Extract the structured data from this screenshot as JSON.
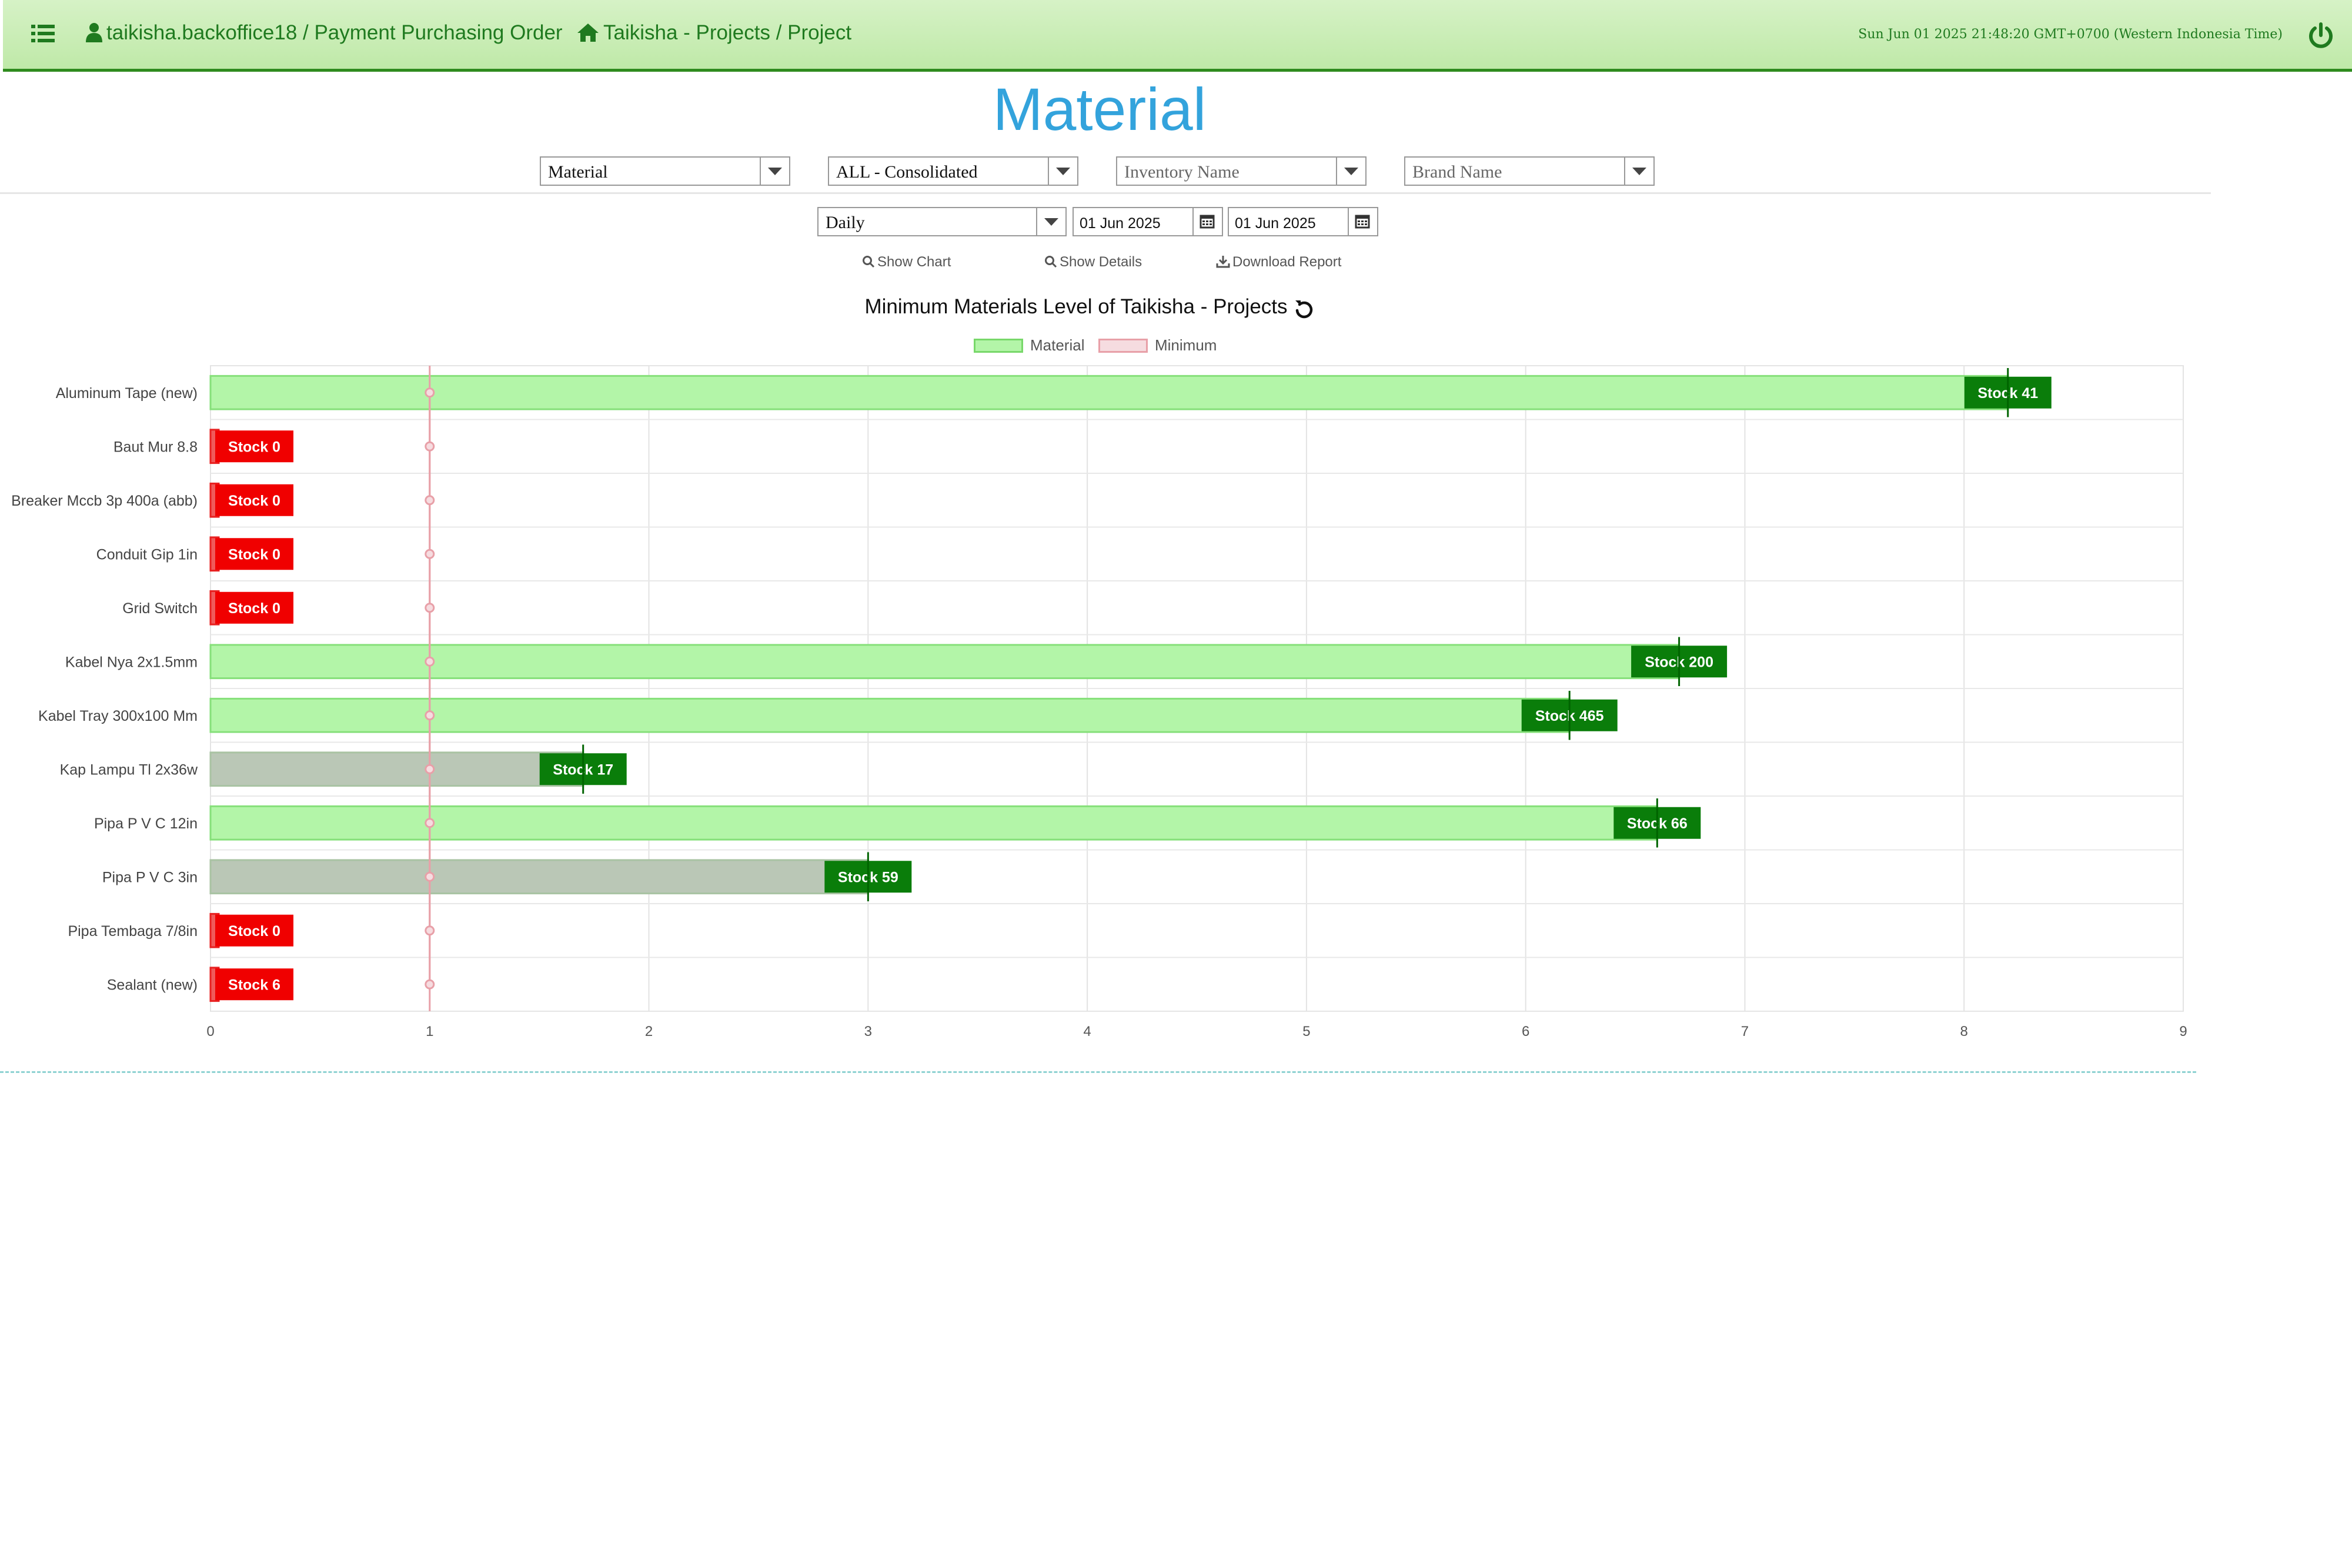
{
  "header": {
    "breadcrumb_user": "taikisha.backoffice18 / Payment Purchasing Order",
    "breadcrumb_home": "Taikisha - Projects / Project",
    "clock": "Sun Jun 01 2025 21:48:20 GMT+0700 (Western Indonesia Time)"
  },
  "page": {
    "title": "Material"
  },
  "filters": {
    "category": "Material",
    "scope": "ALL - Consolidated",
    "inventory_placeholder": "Inventory Name",
    "brand_placeholder": "Brand Name",
    "period": "Daily",
    "date_from": "01 Jun 2025",
    "date_to": "01 Jun 2025"
  },
  "actions": {
    "show_chart": "Show Chart",
    "show_details": "Show Details",
    "download_report": "Download Report"
  },
  "colors": {
    "header_green": "#bfe9a8",
    "title_blue": "#33a3dc",
    "bar_green": "#b3f5a8",
    "bar_grey": "#bac7b6",
    "label_green": "#0a7d0a",
    "label_red": "#f00000",
    "minimum_line": "#e8a0a8"
  },
  "chart_data": {
    "type": "bar",
    "orientation": "horizontal",
    "title": "Minimum Materials Level of Taikisha - Projects",
    "legend": [
      "Material",
      "Minimum"
    ],
    "legend_position": "top",
    "categories": [
      "Aluminum Tape (new)",
      "Baut Mur 8.8",
      "Breaker Mccb 3p 400a (abb)",
      "Conduit Gip 1in",
      "Grid Switch",
      "Kabel Nya 2x1.5mm",
      "Kabel Tray 300x100 Mm",
      "Kap Lampu Tl 2x36w",
      "Pipa P V C 12in",
      "Pipa P V C 3in",
      "Pipa Tembaga 7/8in",
      "Sealant (new)"
    ],
    "series": [
      {
        "name": "Material",
        "values": [
          8.2,
          0,
          0,
          0,
          0,
          6.7,
          6.2,
          1.7,
          6.6,
          3.0,
          0,
          0
        ],
        "labels": [
          "Stock 41",
          "Stock 0",
          "Stock 0",
          "Stock 0",
          "Stock 0",
          "Stock 200",
          "Stock 465",
          "Stock 17",
          "Stock 66",
          "Stock 59",
          "Stock 0",
          "Stock 6"
        ],
        "label_color": [
          "green",
          "red",
          "red",
          "red",
          "red",
          "green",
          "green",
          "green",
          "green",
          "green",
          "red",
          "red"
        ],
        "bar_color": [
          "green",
          "green",
          "green",
          "green",
          "green",
          "green",
          "green",
          "grey",
          "green",
          "grey",
          "green",
          "green"
        ]
      },
      {
        "name": "Minimum",
        "values": [
          1,
          1,
          1,
          1,
          1,
          1,
          1,
          1,
          1,
          1,
          1,
          1
        ]
      }
    ],
    "xticks": [
      0,
      1,
      2,
      3,
      4,
      5,
      6,
      7,
      8,
      9
    ],
    "xlim": [
      0,
      9
    ],
    "grid": true
  }
}
